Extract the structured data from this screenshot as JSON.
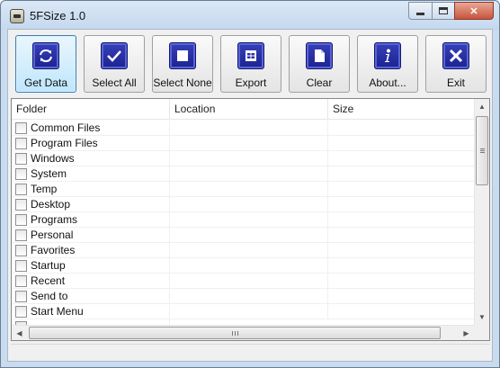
{
  "window": {
    "title": "5FSize 1.0",
    "icon": "app-drive-icon"
  },
  "caption_buttons": {
    "minimize_icon": "minimize-icon",
    "maximize_icon": "maximize-icon",
    "close_glyph": "✕"
  },
  "toolbar": {
    "buttons": [
      {
        "label": "Get Data",
        "icon": "refresh-icon",
        "active": true
      },
      {
        "label": "Select All",
        "icon": "checkmark-icon"
      },
      {
        "label": "Select None",
        "icon": "square-icon"
      },
      {
        "label": "Export",
        "icon": "table-icon"
      },
      {
        "label": "Clear",
        "icon": "document-icon"
      },
      {
        "label": "About...",
        "icon": "info-icon"
      },
      {
        "label": "Exit",
        "icon": "close-icon"
      }
    ]
  },
  "list": {
    "columns": [
      "Folder",
      "Location",
      "Size"
    ],
    "rows": [
      {
        "folder": "Common Files",
        "location": "",
        "size": "",
        "checked": false
      },
      {
        "folder": "Program Files",
        "location": "",
        "size": "",
        "checked": false
      },
      {
        "folder": "Windows",
        "location": "",
        "size": "",
        "checked": false
      },
      {
        "folder": "System",
        "location": "",
        "size": "",
        "checked": false
      },
      {
        "folder": "Temp",
        "location": "",
        "size": "",
        "checked": false
      },
      {
        "folder": "Desktop",
        "location": "",
        "size": "",
        "checked": false
      },
      {
        "folder": "Programs",
        "location": "",
        "size": "",
        "checked": false
      },
      {
        "folder": "Personal",
        "location": "",
        "size": "",
        "checked": false
      },
      {
        "folder": "Favorites",
        "location": "",
        "size": "",
        "checked": false
      },
      {
        "folder": "Startup",
        "location": "",
        "size": "",
        "checked": false
      },
      {
        "folder": "Recent",
        "location": "",
        "size": "",
        "checked": false
      },
      {
        "folder": "Send to",
        "location": "",
        "size": "",
        "checked": false
      },
      {
        "folder": "Start Menu",
        "location": "",
        "size": "",
        "checked": false
      }
    ]
  },
  "colors": {
    "toolbar_icon": "#2a30a8",
    "active_button": "#bee6fd",
    "frame": "#c9dbee"
  }
}
